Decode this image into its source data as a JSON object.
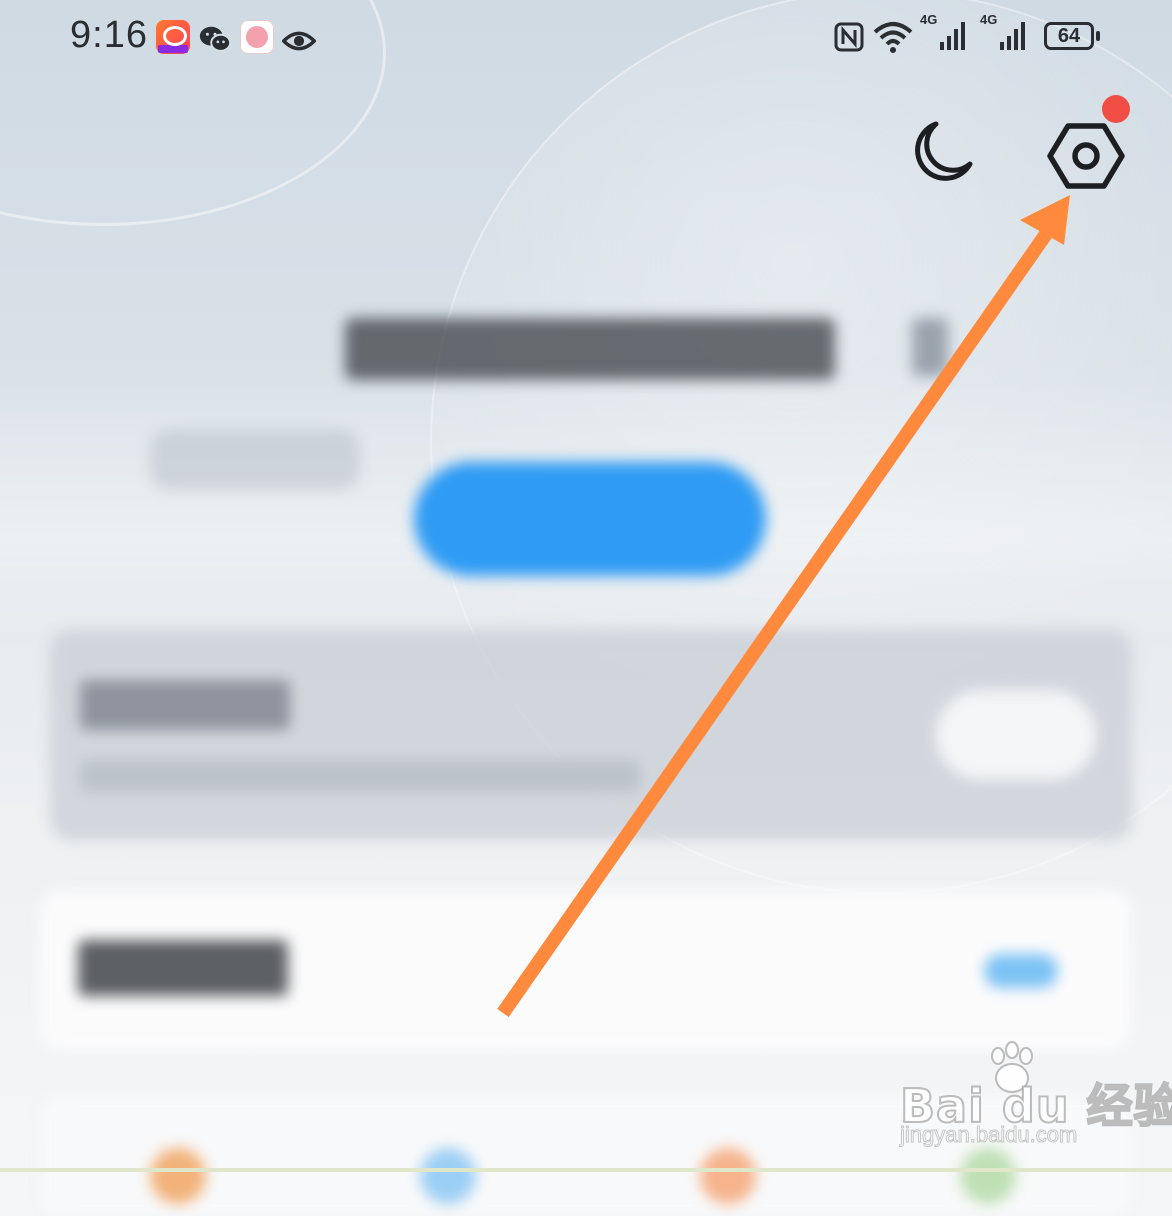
{
  "status_bar": {
    "time": "9:16",
    "network_1": "4G",
    "network_2": "4G",
    "battery": "64",
    "app_icons": [
      "kuaishou-icon",
      "wechat-icon",
      "pink-app-icon",
      "eye-icon"
    ]
  },
  "top_actions": {
    "night_mode_icon": "moon-icon",
    "settings_icon": "hexagon-settings-icon",
    "has_notification": true
  },
  "content": {
    "headline": "",
    "cta_label": "",
    "card1": {
      "title": "",
      "description": "",
      "button": ""
    },
    "card2": {
      "title": "",
      "link": ""
    }
  },
  "annotation": {
    "type": "arrow",
    "color": "#ff8a3d",
    "points_to": "settings"
  },
  "watermark": {
    "brand": "Bai du 经验",
    "url": "jingyan.baidu.com"
  },
  "colors": {
    "accent_blue": "#2f9bf4",
    "notification_red": "#f04e45",
    "arrow_orange": "#ff8a3d"
  }
}
